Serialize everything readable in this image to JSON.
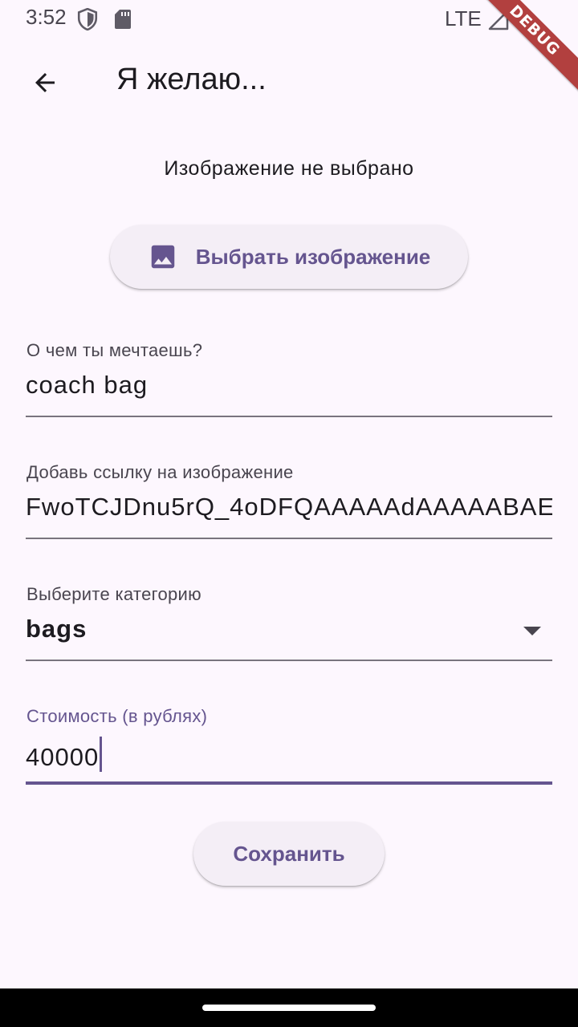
{
  "status_bar": {
    "time": "3:52",
    "network": "LTE",
    "icons": [
      "shield-icon",
      "sd-card-icon",
      "signal-icon",
      "battery-icon"
    ],
    "debug_banner": "DEBUG"
  },
  "app_bar": {
    "title": "Я желаю...",
    "back_icon": "arrow-back-icon"
  },
  "image_section": {
    "status_text": "Изображение не выбрано",
    "pick_button_label": "Выбрать изображение",
    "pick_button_icon": "image-icon"
  },
  "form": {
    "dream": {
      "label": "О чем ты мечтаешь?",
      "value": "coach bag"
    },
    "image_link": {
      "label": "Добавь ссылку на изображение",
      "value": "FwoTCJDnu5rQ_4oDFQAAAAAdAAAAABAE"
    },
    "category": {
      "label": "Выберите категорию",
      "value": "bags",
      "icon": "dropdown-arrow-icon"
    },
    "price": {
      "label": "Стоимость (в рублях)",
      "value": "40000",
      "focused": true
    }
  },
  "save_button_label": "Сохранить",
  "colors": {
    "background": "#fdf7fe",
    "primary": "#65558f",
    "button_bg": "#f4eef6",
    "text": "#1d1b20",
    "label": "#49454f",
    "underline": "#79747e",
    "debug_banner": "#b2403f"
  }
}
